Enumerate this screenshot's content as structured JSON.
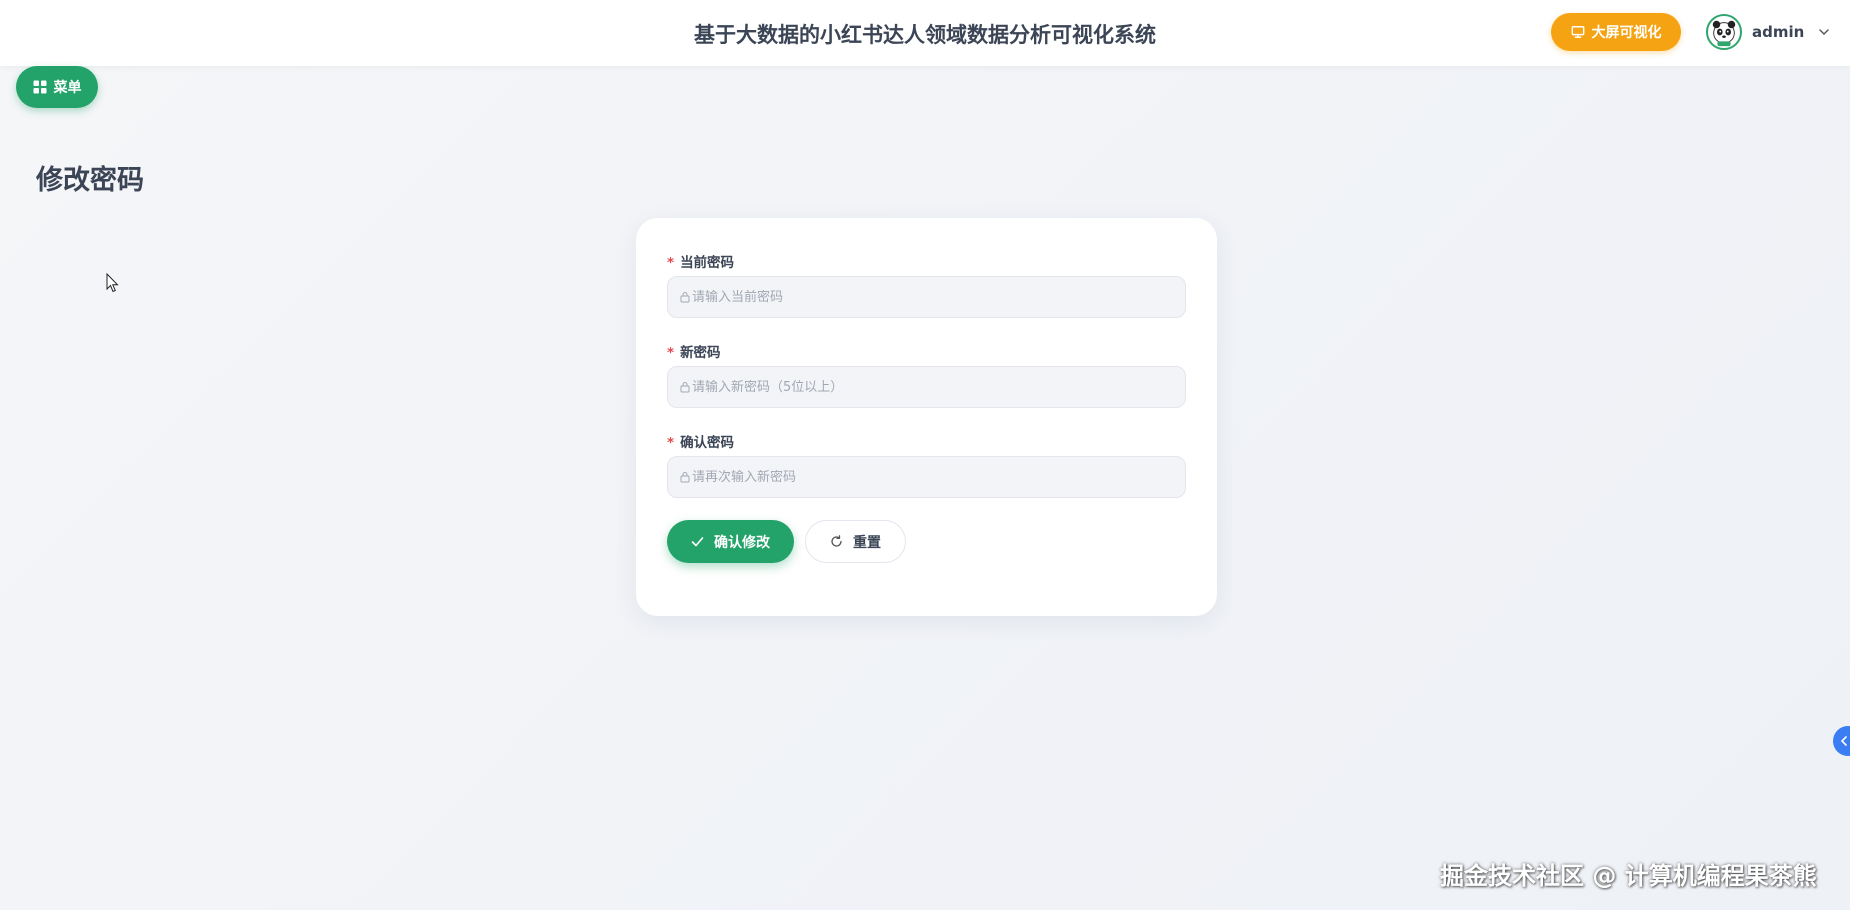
{
  "header": {
    "app_title": "基于大数据的小红书达人领域数据分析可视化系统",
    "screen_button_label": "大屏可视化",
    "user_name": "admin"
  },
  "menu_button_label": "菜单",
  "page_title": "修改密码",
  "form": {
    "current_password": {
      "label": "当前密码",
      "required_mark": "*",
      "placeholder": "请输入当前密码",
      "value": ""
    },
    "new_password": {
      "label": "新密码",
      "required_mark": "*",
      "placeholder": "请输入新密码（5位以上）",
      "value": ""
    },
    "confirm_password": {
      "label": "确认密码",
      "required_mark": "*",
      "placeholder": "请再次输入新密码",
      "value": ""
    },
    "confirm_button_label": "确认修改",
    "reset_button_label": "重置"
  },
  "watermark": "掘金技术社区 @ 计算机编程果茶熊",
  "colors": {
    "primary_green": "#23a36a",
    "accent_orange": "#f5a312",
    "required_red": "#e5484d",
    "side_tab_blue": "#3b7df2",
    "title_text": "#3b4556"
  },
  "icons": {
    "screen_button": "monitor-icon",
    "menu_button": "grid-icon",
    "avatar": "panda-avatar",
    "user_dropdown": "chevron-down-icon",
    "input_prefix": "lock-icon",
    "confirm_button": "check-icon",
    "reset_button": "refresh-icon",
    "side_tab": "chevron-left-icon"
  }
}
